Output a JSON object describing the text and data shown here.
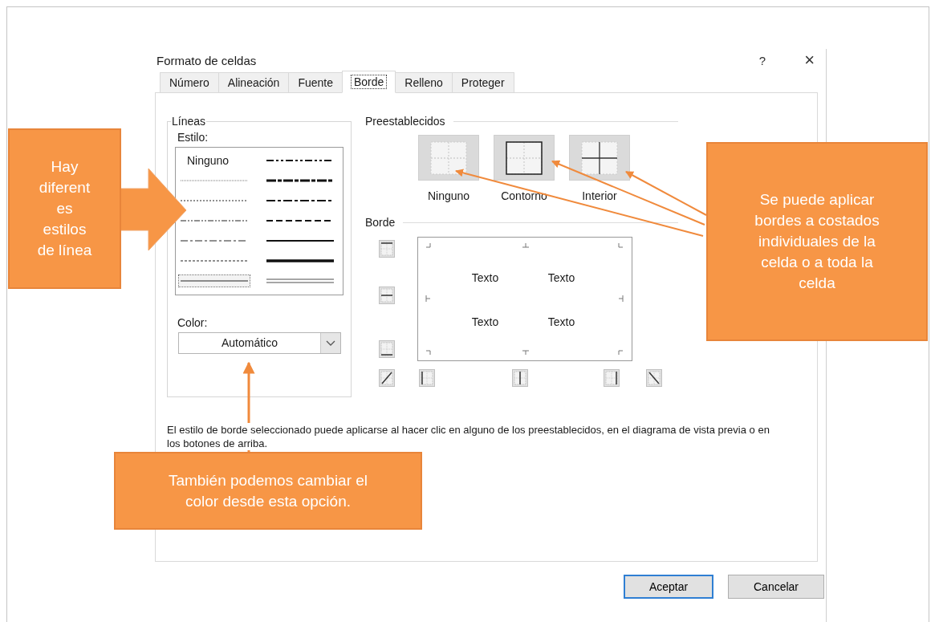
{
  "dialog": {
    "title": "Formato de celdas",
    "help": "?",
    "close": "×"
  },
  "tabs": [
    {
      "label": "Número",
      "selected": false
    },
    {
      "label": "Alineación",
      "selected": false
    },
    {
      "label": "Fuente",
      "selected": false
    },
    {
      "label": "Borde",
      "selected": true
    },
    {
      "label": "Relleno",
      "selected": false
    },
    {
      "label": "Proteger",
      "selected": false
    }
  ],
  "lines": {
    "title": "Líneas",
    "style_label": "Estilo:",
    "styles": [
      {
        "kind": "none",
        "label": "Ninguno",
        "selected": false
      },
      {
        "kind": "hair",
        "selected": false
      },
      {
        "kind": "dotted",
        "selected": false
      },
      {
        "kind": "dash-dot-dot",
        "selected": false
      },
      {
        "kind": "dash-dot",
        "selected": false
      },
      {
        "kind": "dashed",
        "selected": false
      },
      {
        "kind": "thin",
        "selected": true
      },
      {
        "kind": "medium-dash-dot-dot",
        "selected": false
      },
      {
        "kind": "slant-dash-dot",
        "selected": false
      },
      {
        "kind": "medium-dash-dot",
        "selected": false
      },
      {
        "kind": "medium-dashed",
        "selected": false
      },
      {
        "kind": "medium",
        "selected": false
      },
      {
        "kind": "thick",
        "selected": false
      },
      {
        "kind": "double",
        "selected": false
      }
    ],
    "color_label": "Color:",
    "color_value": "Automático"
  },
  "presets": {
    "title": "Preestablecidos",
    "items": [
      {
        "kind": "none",
        "label": "Ninguno"
      },
      {
        "kind": "outline",
        "label": "Contorno"
      },
      {
        "kind": "inside",
        "label": "Interior"
      }
    ]
  },
  "border": {
    "title": "Borde",
    "side_buttons": [
      {
        "kind": "top"
      },
      {
        "kind": "middle-horizontal"
      },
      {
        "kind": "bottom"
      }
    ],
    "bottom_buttons": [
      {
        "kind": "diagonal-up"
      },
      {
        "kind": "left"
      },
      {
        "kind": "middle-vertical"
      },
      {
        "kind": "right"
      },
      {
        "kind": "diagonal-down"
      }
    ],
    "preview_texts": [
      "Texto",
      "Texto",
      "Texto",
      "Texto"
    ]
  },
  "description": "El estilo de borde seleccionado puede aplicarse al hacer clic en alguno de los preestablecidos, en el diagrama de vista previa o en los botones de arriba.",
  "buttons": [
    {
      "label": "Aceptar",
      "default": true
    },
    {
      "label": "Cancelar",
      "default": false
    }
  ],
  "callouts": [
    {
      "kind": "left",
      "text": "Hay diferent es estilos de línea"
    },
    {
      "kind": "right",
      "text": "Se puede aplicar bordes a costados individuales de la celda o a toda la celda"
    },
    {
      "kind": "bottom",
      "text": "También podemos cambiar el color desde esta opción."
    }
  ]
}
